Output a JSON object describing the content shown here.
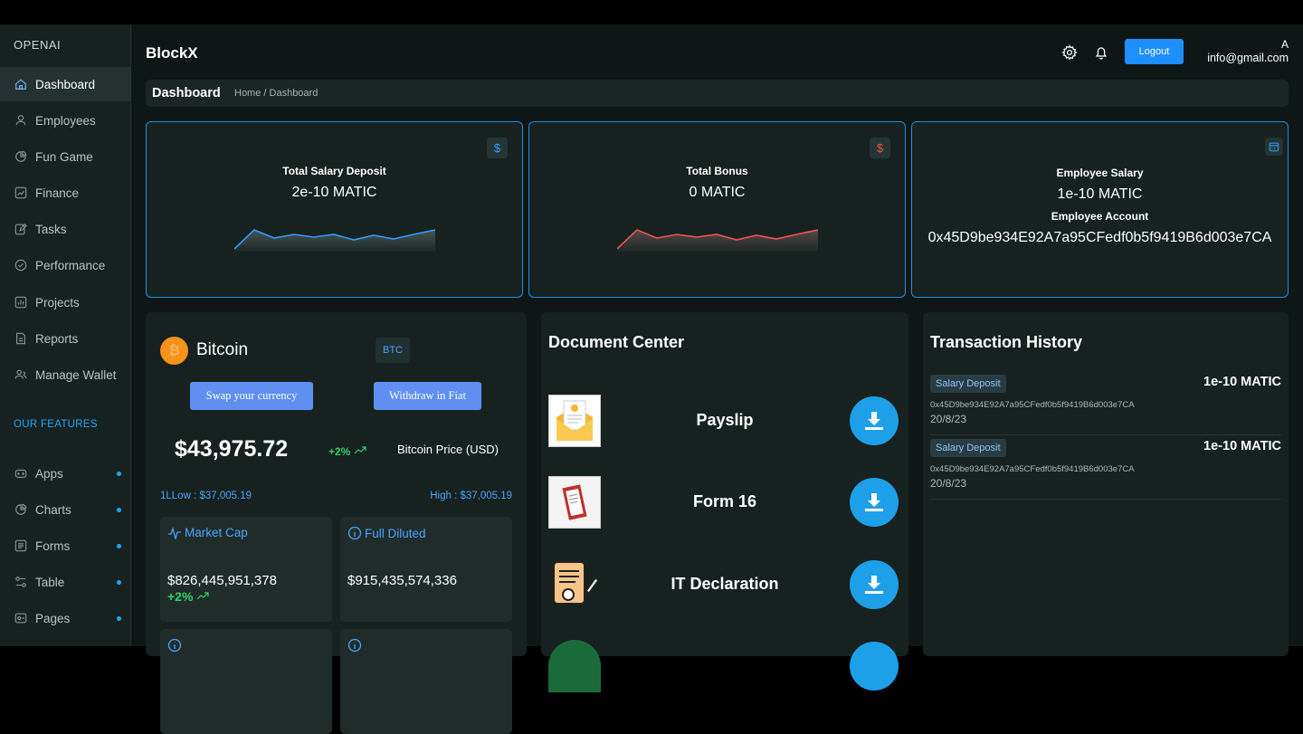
{
  "sidebar": {
    "brand": "OPENAI",
    "items": [
      {
        "label": "Dashboard",
        "icon": "home-icon"
      },
      {
        "label": "Employees",
        "icon": "user-icon"
      },
      {
        "label": "Fun Game",
        "icon": "pie-icon"
      },
      {
        "label": "Finance",
        "icon": "chart-icon"
      },
      {
        "label": "Tasks",
        "icon": "edit-icon"
      },
      {
        "label": "Performance",
        "icon": "check-circle-icon"
      },
      {
        "label": "Projects",
        "icon": "bar-chart-icon"
      },
      {
        "label": "Reports",
        "icon": "document-icon"
      },
      {
        "label": "Manage Wallet",
        "icon": "users-icon"
      }
    ],
    "features_title": "OUR FEATURES",
    "features": [
      {
        "label": "Apps",
        "icon": "gamepad-icon"
      },
      {
        "label": "Charts",
        "icon": "pie-icon"
      },
      {
        "label": "Forms",
        "icon": "form-icon"
      },
      {
        "label": "Table",
        "icon": "sliders-icon"
      },
      {
        "label": "Pages",
        "icon": "pages-icon"
      }
    ]
  },
  "header": {
    "title": "BlockX",
    "logout_label": "Logout",
    "user_initial": "A",
    "user_email": "info@gmail.com"
  },
  "breadcrumb": {
    "title": "Dashboard",
    "path": "Home / Dashboard"
  },
  "stats": {
    "salary": {
      "label": "Total Salary Deposit",
      "value": "2e-10 MATIC",
      "icon_text": "$"
    },
    "bonus": {
      "label": "Total Bonus",
      "value": "0 MATIC",
      "icon_text": "$"
    },
    "employee": {
      "label": "Employee Salary",
      "value": "1e-10 MATIC",
      "account_label": "Employee Account",
      "account": "0x45D9be934E92A7a95CFedf0b5f9419B6d003e7CA"
    }
  },
  "bitcoin": {
    "name": "Bitcoin",
    "tag": "BTC",
    "swap_label": "Swap your currency",
    "withdraw_label": "Withdraw in Fiat",
    "price": "$43,975.72",
    "change": "+2%",
    "price_label": "Bitcoin Price (USD)",
    "low": "1LLow : $37,005.19",
    "high": "High : $37,005.19",
    "market_cap_title": "Market Cap",
    "market_cap": "$826,445,951,378",
    "market_cap_change": "+2%",
    "full_diluted_title": "Full Diluted",
    "full_diluted": "$915,435,574,336"
  },
  "documents": {
    "title": "Document Center",
    "items": [
      {
        "name": "Payslip"
      },
      {
        "name": "Form 16"
      },
      {
        "name": "IT Declaration"
      }
    ]
  },
  "transactions": {
    "title": "Transaction History",
    "items": [
      {
        "type": "Salary Deposit",
        "amount": "1e-10 MATIC",
        "address": "0x45D9be934E92A7a95CFedf0b5f9419B6d003e7CA",
        "date": "20/8/23"
      },
      {
        "type": "Salary Deposit",
        "amount": "1e-10 MATIC",
        "address": "0x45D9be934E92A7a95CFedf0b5f9419B6d003e7CA",
        "date": "20/8/23"
      }
    ]
  },
  "colors": {
    "accent": "#1e8fff",
    "positive": "#2ed36a",
    "bitcoin": "#f7931a",
    "spark_blue": "#2d9cff",
    "spark_red": "#f05252"
  }
}
